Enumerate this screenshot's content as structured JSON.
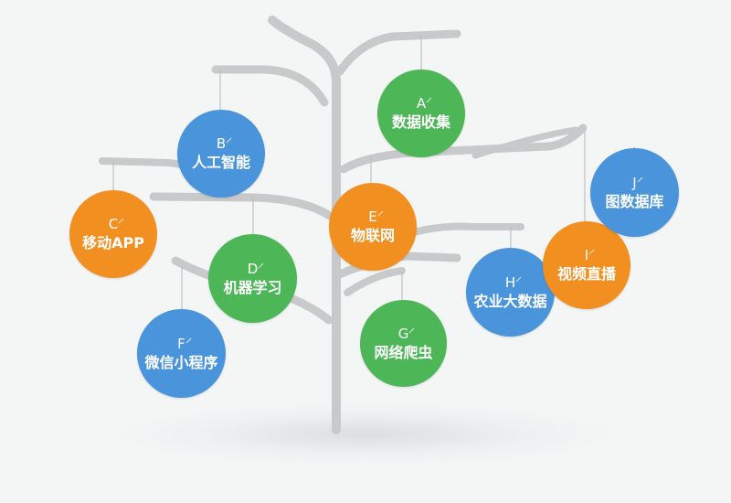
{
  "nodes": [
    {
      "id": "A",
      "letter": "A",
      "label": "数据收集",
      "color": "green"
    },
    {
      "id": "B",
      "letter": "B",
      "label": "人工智能",
      "color": "blue"
    },
    {
      "id": "C",
      "letter": "C",
      "label": "移动APP",
      "color": "orange"
    },
    {
      "id": "D",
      "letter": "D",
      "label": "机器学习",
      "color": "green"
    },
    {
      "id": "E",
      "letter": "E",
      "label": "物联网",
      "color": "orange"
    },
    {
      "id": "F",
      "letter": "F",
      "label": "微信小程序",
      "color": "blue"
    },
    {
      "id": "G",
      "letter": "G",
      "label": "网络爬虫",
      "color": "green"
    },
    {
      "id": "H",
      "letter": "H",
      "label": "农业大数据",
      "color": "blue"
    },
    {
      "id": "I",
      "letter": "I",
      "label": "视频直播",
      "color": "orange"
    },
    {
      "id": "J",
      "letter": "J",
      "label": "图数据库",
      "color": "blue"
    }
  ],
  "colors": {
    "green": "#4db657",
    "blue": "#4a94db",
    "orange": "#f18f20",
    "branch": "#c7c9cb"
  }
}
